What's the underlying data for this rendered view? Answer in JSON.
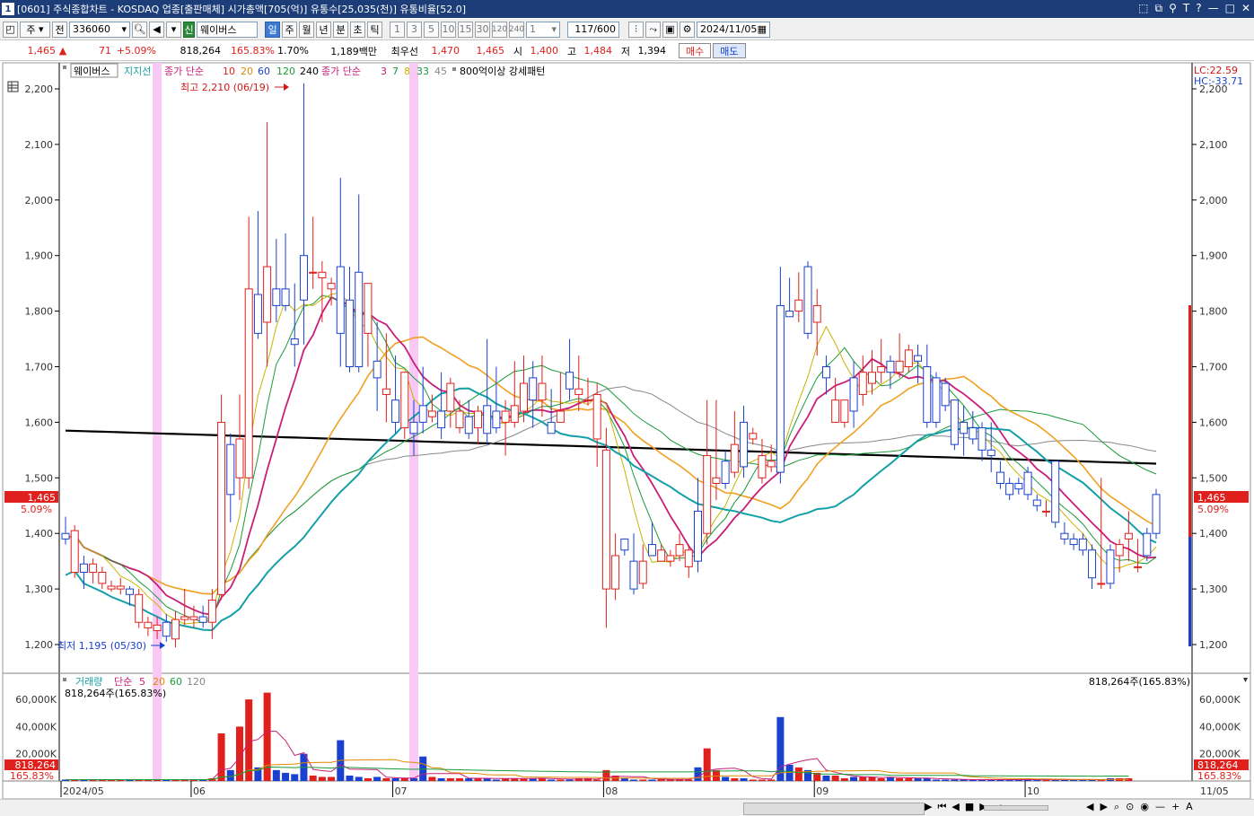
{
  "titlebar": {
    "window_number": "1",
    "title": "[0601] 주식종합차트 - KOSDAQ 업종[출판매체] 시가총액[705(억)] 유통수[25,035(천)] 유통비율[52.0]",
    "controls": [
      "⬚",
      "⧉",
      "⚲",
      "T",
      "?",
      "—",
      "□",
      "✕"
    ]
  },
  "toolbar": {
    "market": "주",
    "prev": "전",
    "code": "336060",
    "badge": "신",
    "chart_name": "웨이버스",
    "periods": [
      "일",
      "주",
      "월",
      "년",
      "분",
      "초",
      "틱"
    ],
    "selected_period": "일",
    "intervals": [
      "1",
      "3",
      "5",
      "10",
      "15",
      "30",
      "120",
      "240"
    ],
    "interval_value": "1",
    "count": "117",
    "count_max": "/600",
    "date": "2024/11/05"
  },
  "quote": {
    "price": "1,465",
    "arrow": "▲",
    "change": "71",
    "change_pct": "+5.09%",
    "volume": "818,264",
    "volume_ratio": "165.83%",
    "turnover": "1.70%",
    "amount": "1,189백만",
    "pref_label": "최우선",
    "ask": "1,470",
    "bid": "1,465",
    "open_label": "시",
    "open": "1,400",
    "high_label": "고",
    "high": "1,484",
    "low_label": "저",
    "low": "1,394",
    "buy_label": "매수",
    "sell_label": "매도"
  },
  "legend": {
    "stock": "웨이버스",
    "support": "지지선",
    "ma_label_a": "종가 단순",
    "ma_a": [
      "10",
      "20",
      "60",
      "120",
      "240"
    ],
    "ma_label_b": "종가 단순",
    "ma_b": [
      "3",
      "7",
      "8",
      "33",
      "45"
    ],
    "pattern": "800억이상 강세패턴"
  },
  "annotations": {
    "high": "최고 2,210 (06/19)",
    "low": "최저 1,195 (05/30)",
    "lc": "LC:22.59",
    "hc": "HC:-33.71",
    "price_tag": "1,465",
    "pct_tag": "5.09%"
  },
  "volume_panel": {
    "legend_name": "거래량",
    "legend_ma": "단순",
    "ma": [
      "5",
      "20",
      "60",
      "120"
    ],
    "current_left": "818,264주(165.83%)",
    "current_right": "818,264주(165.83%)",
    "tag_value": "818,264",
    "tag_pct": "165.83%",
    "ticks": [
      "60,000K",
      "40,000K",
      "20,000K"
    ]
  },
  "chart_data": {
    "type": "candlestick",
    "price_ticks": [
      "2,200",
      "2,100",
      "2,000",
      "1,900",
      "1,800",
      "1,700",
      "1,600",
      "1,500",
      "1,400",
      "1,300",
      "1,200"
    ],
    "ylim": [
      1160,
      2230
    ],
    "x_months": [
      "2024/05",
      "06",
      "07",
      "08",
      "09",
      "10",
      "11"
    ],
    "x_right": "11/05",
    "last_close": 1465,
    "highlight_days": [
      10,
      38
    ],
    "candles": [
      [
        1400,
        1390,
        1430,
        1380
      ],
      [
        1330,
        1405,
        1415,
        1320
      ],
      [
        1345,
        1330,
        1360,
        1300
      ],
      [
        1330,
        1345,
        1355,
        1310
      ],
      [
        1310,
        1330,
        1340,
        1300
      ],
      [
        1300,
        1305,
        1315,
        1295
      ],
      [
        1300,
        1305,
        1320,
        1290
      ],
      [
        1300,
        1290,
        1305,
        1270
      ],
      [
        1240,
        1290,
        1300,
        1230
      ],
      [
        1230,
        1240,
        1250,
        1215
      ],
      [
        1225,
        1235,
        1250,
        1210
      ],
      [
        1240,
        1215,
        1255,
        1205
      ],
      [
        1210,
        1245,
        1260,
        1195
      ],
      [
        1245,
        1250,
        1300,
        1235
      ],
      [
        1245,
        1250,
        1270,
        1230
      ],
      [
        1250,
        1240,
        1270,
        1230
      ],
      [
        1240,
        1280,
        1300,
        1210
      ],
      [
        1290,
        1600,
        1650,
        1280
      ],
      [
        1560,
        1470,
        1580,
        1420
      ],
      [
        1500,
        1570,
        1650,
        1460
      ],
      [
        1500,
        1840,
        1970,
        1480
      ],
      [
        1830,
        1760,
        1980,
        1750
      ],
      [
        1780,
        1880,
        2140,
        1700
      ],
      [
        1840,
        1810,
        1930,
        1780
      ],
      [
        1840,
        1810,
        1940,
        1800
      ],
      [
        1750,
        1740,
        1850,
        1700
      ],
      [
        1900,
        1820,
        2210,
        1740
      ],
      [
        1870,
        1870,
        1970,
        1840
      ],
      [
        1860,
        1870,
        1890,
        1780
      ],
      [
        1840,
        1850,
        1860,
        1810
      ],
      [
        1880,
        1760,
        2040,
        1700
      ],
      [
        1820,
        1700,
        1880,
        1690
      ],
      [
        1870,
        1700,
        2010,
        1690
      ],
      [
        1760,
        1850,
        1790,
        1700
      ],
      [
        1710,
        1680,
        1780,
        1620
      ],
      [
        1650,
        1660,
        1760,
        1600
      ],
      [
        1640,
        1600,
        1720,
        1580
      ],
      [
        1590,
        1690,
        1670,
        1570
      ],
      [
        1600,
        1580,
        1640,
        1540
      ],
      [
        1630,
        1600,
        1700,
        1580
      ],
      [
        1610,
        1620,
        1650,
        1600
      ],
      [
        1620,
        1590,
        1690,
        1570
      ],
      [
        1620,
        1670,
        1680,
        1590
      ],
      [
        1590,
        1620,
        1640,
        1580
      ],
      [
        1610,
        1580,
        1640,
        1570
      ],
      [
        1590,
        1620,
        1630,
        1560
      ],
      [
        1630,
        1580,
        1750,
        1560
      ],
      [
        1620,
        1590,
        1700,
        1580
      ],
      [
        1600,
        1620,
        1640,
        1540
      ],
      [
        1600,
        1630,
        1710,
        1590
      ],
      [
        1620,
        1670,
        1720,
        1600
      ],
      [
        1680,
        1640,
        1710,
        1590
      ],
      [
        1640,
        1670,
        1720,
        1610
      ],
      [
        1600,
        1580,
        1660,
        1580
      ],
      [
        1600,
        1620,
        1690,
        1600
      ],
      [
        1690,
        1660,
        1750,
        1640
      ],
      [
        1650,
        1660,
        1720,
        1620
      ],
      [
        1640,
        1640,
        1680,
        1630
      ],
      [
        1570,
        1650,
        1670,
        1520
      ],
      [
        1300,
        1550,
        1590,
        1230
      ],
      [
        1300,
        1360,
        1400,
        1280
      ],
      [
        1390,
        1370,
        1390,
        1360
      ],
      [
        1350,
        1300,
        1400,
        1290
      ],
      [
        1310,
        1350,
        1380,
        1300
      ],
      [
        1380,
        1360,
        1420,
        1370
      ],
      [
        1350,
        1370,
        1380,
        1350
      ],
      [
        1350,
        1360,
        1370,
        1340
      ],
      [
        1360,
        1380,
        1400,
        1350
      ],
      [
        1340,
        1370,
        1380,
        1320
      ],
      [
        1440,
        1350,
        1500,
        1330
      ],
      [
        1400,
        1540,
        1640,
        1380
      ],
      [
        1490,
        1500,
        1640,
        1460
      ],
      [
        1530,
        1490,
        1550,
        1480
      ],
      [
        1510,
        1560,
        1620,
        1500
      ],
      [
        1600,
        1520,
        1630,
        1500
      ],
      [
        1570,
        1580,
        1590,
        1560
      ],
      [
        1500,
        1540,
        1570,
        1490
      ],
      [
        1520,
        1530,
        1560,
        1510
      ],
      [
        1810,
        1510,
        1880,
        1490
      ],
      [
        1800,
        1790,
        1860,
        1790
      ],
      [
        1800,
        1820,
        1870,
        1780
      ],
      [
        1880,
        1760,
        1890,
        1750
      ],
      [
        1780,
        1810,
        1840,
        1720
      ],
      [
        1700,
        1680,
        1720,
        1650
      ],
      [
        1600,
        1640,
        1680,
        1600
      ],
      [
        1600,
        1640,
        1640,
        1590
      ],
      [
        1680,
        1620,
        1710,
        1590
      ],
      [
        1650,
        1690,
        1720,
        1630
      ],
      [
        1670,
        1690,
        1730,
        1650
      ],
      [
        1690,
        1700,
        1750,
        1670
      ],
      [
        1710,
        1690,
        1720,
        1660
      ],
      [
        1690,
        1710,
        1760,
        1680
      ],
      [
        1700,
        1730,
        1740,
        1690
      ],
      [
        1720,
        1710,
        1740,
        1670
      ],
      [
        1700,
        1600,
        1740,
        1590
      ],
      [
        1680,
        1600,
        1690,
        1590
      ],
      [
        1670,
        1630,
        1680,
        1620
      ],
      [
        1640,
        1560,
        1640,
        1550
      ],
      [
        1600,
        1580,
        1630,
        1540
      ],
      [
        1590,
        1570,
        1620,
        1560
      ],
      [
        1590,
        1550,
        1600,
        1530
      ],
      [
        1550,
        1540,
        1600,
        1510
      ],
      [
        1510,
        1490,
        1530,
        1480
      ],
      [
        1490,
        1470,
        1500,
        1460
      ],
      [
        1490,
        1480,
        1500,
        1470
      ],
      [
        1510,
        1470,
        1520,
        1460
      ],
      [
        1460,
        1450,
        1470,
        1440
      ],
      [
        1440,
        1440,
        1460,
        1430
      ],
      [
        1530,
        1420,
        1530,
        1410
      ],
      [
        1400,
        1390,
        1420,
        1380
      ],
      [
        1390,
        1380,
        1400,
        1370
      ],
      [
        1390,
        1370,
        1400,
        1360
      ],
      [
        1370,
        1320,
        1380,
        1300
      ],
      [
        1310,
        1310,
        1500,
        1300
      ],
      [
        1370,
        1310,
        1380,
        1300
      ],
      [
        1360,
        1380,
        1390,
        1330
      ],
      [
        1390,
        1400,
        1440,
        1350
      ],
      [
        1340,
        1340,
        1390,
        1330
      ],
      [
        1400,
        1360,
        1410,
        1350
      ],
      [
        1470,
        1400,
        1480,
        1390
      ]
    ],
    "volume_k": [
      1,
      1,
      1,
      1,
      1,
      1,
      1,
      1,
      1,
      1,
      1,
      1,
      1,
      1,
      1,
      1,
      2,
      35,
      8,
      40,
      60,
      10,
      65,
      8,
      6,
      5,
      20,
      4,
      3,
      3,
      30,
      4,
      3,
      2,
      3,
      2,
      2,
      2,
      2,
      18,
      3,
      2,
      2,
      2,
      2,
      2,
      2,
      1,
      2,
      2,
      2,
      2,
      2,
      1,
      1,
      1,
      2,
      2,
      1,
      8,
      4,
      2,
      1,
      1,
      1,
      2,
      1,
      1,
      1,
      10,
      24,
      8,
      3,
      2,
      2,
      1,
      1,
      1,
      47,
      12,
      10,
      8,
      6,
      4,
      4,
      2,
      3,
      3,
      3,
      2,
      3,
      2,
      2,
      2,
      2,
      1,
      1,
      1,
      1,
      1,
      1,
      1,
      1,
      1,
      1,
      1,
      1,
      1,
      1,
      1,
      1,
      1,
      1,
      1,
      2,
      2,
      2
    ]
  }
}
